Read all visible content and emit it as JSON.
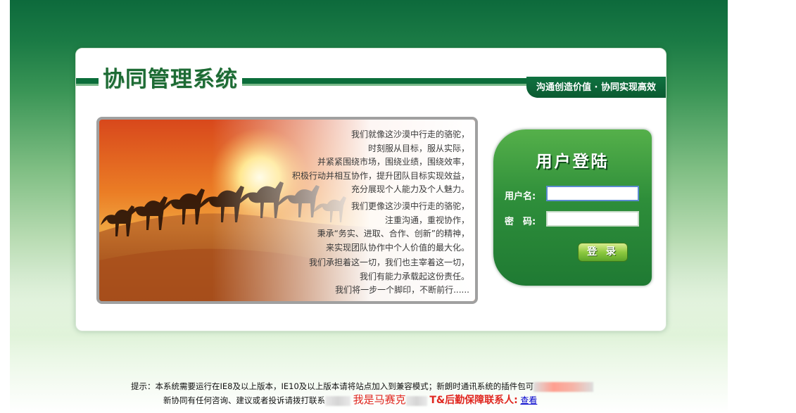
{
  "app": {
    "title": "协同管理系统",
    "slogan": "沟通创造价值 · 协同实现高效"
  },
  "intro": {
    "paragraph1": [
      "我们就像这沙漠中行走的骆驼，",
      "时刻服从目标，服从实际，",
      "并紧紧围绕市场，围绕业绩，围绕效率，",
      "积极行动并相互协作，提升团队目标实现效益，",
      "充分展现个人能力及个人魅力。"
    ],
    "paragraph2": [
      "我们更像这沙漠中行走的骆驼，",
      "注重沟通，重视协作，",
      "秉承“务实、进取、合作、创新”的精神，",
      "来实现团队协作中个人价值的最大化。"
    ],
    "paragraph3": [
      "我们承担着这一切，我们也主宰着这一切，",
      "我们有能力承载起这份责任。",
      "我们将一步一个脚印，不断前行......"
    ]
  },
  "login": {
    "title": "用户登陆",
    "username_label": "用户名:",
    "username_value": "",
    "password_label": "密　码:",
    "password_value": "",
    "submit_label": "登 录"
  },
  "notice": {
    "line1": "提示：本系统需要运行在IE8及以上版本，IE10及以上版本请将站点加入到兼容模式；新朗时通讯系统的插件包可",
    "line2_prefix": "新协同有任何咨询、建议或者投诉请拨打联系",
    "line2_red": "我是马赛克",
    "line2_contact": "T&后勤保障联系人:",
    "line2_link": "查看"
  },
  "colors": {
    "brand_green": "#0b6d3a",
    "login_green": "#2e8e3a",
    "alert_red": "#e0261f",
    "link_blue": "#0000cc"
  }
}
